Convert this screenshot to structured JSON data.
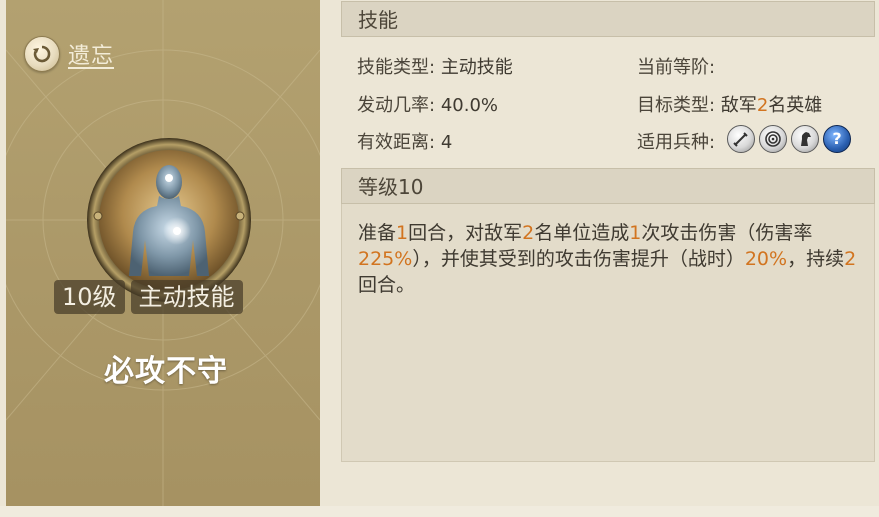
{
  "left": {
    "forget_label": "遗忘",
    "level_badge": "10级",
    "type_badge": "主动技能",
    "skill_name": "必攻不守"
  },
  "skills_section": {
    "title": "技能",
    "skill_type_key": "技能类型:",
    "skill_type_value": "主动技能",
    "trigger_rate_key": "发动几率:",
    "trigger_rate_value": "40.0%",
    "range_key": "有效距离:",
    "range_value": "4",
    "current_tier_key": "当前等阶:",
    "current_tier_value": "",
    "target_type_key": "目标类型:",
    "target_type_prefix": "敌军",
    "target_type_count": "2",
    "target_type_suffix": "名英雄",
    "troop_types_key": "适用兵种:",
    "troop_icons": [
      "sword-icon",
      "target-icon",
      "horse-icon",
      "question-icon"
    ]
  },
  "level_section": {
    "title": "等级10",
    "desc": {
      "p1": "准备",
      "n1": "1",
      "p2": "回合，对敌军",
      "n2": "2",
      "p3": "名单位造成",
      "n3": "1",
      "p4": "次攻击伤害（伤害率",
      "n4": "225%",
      "p5": "），并使其受到的攻击伤害提升（战时）",
      "n5": "20%",
      "p6": "，持续",
      "n6": "2",
      "p7": "回合。"
    }
  },
  "colors": {
    "highlight": "#d2741f",
    "left_card": "#ab9868",
    "panel_bg": "#ece6d6"
  }
}
